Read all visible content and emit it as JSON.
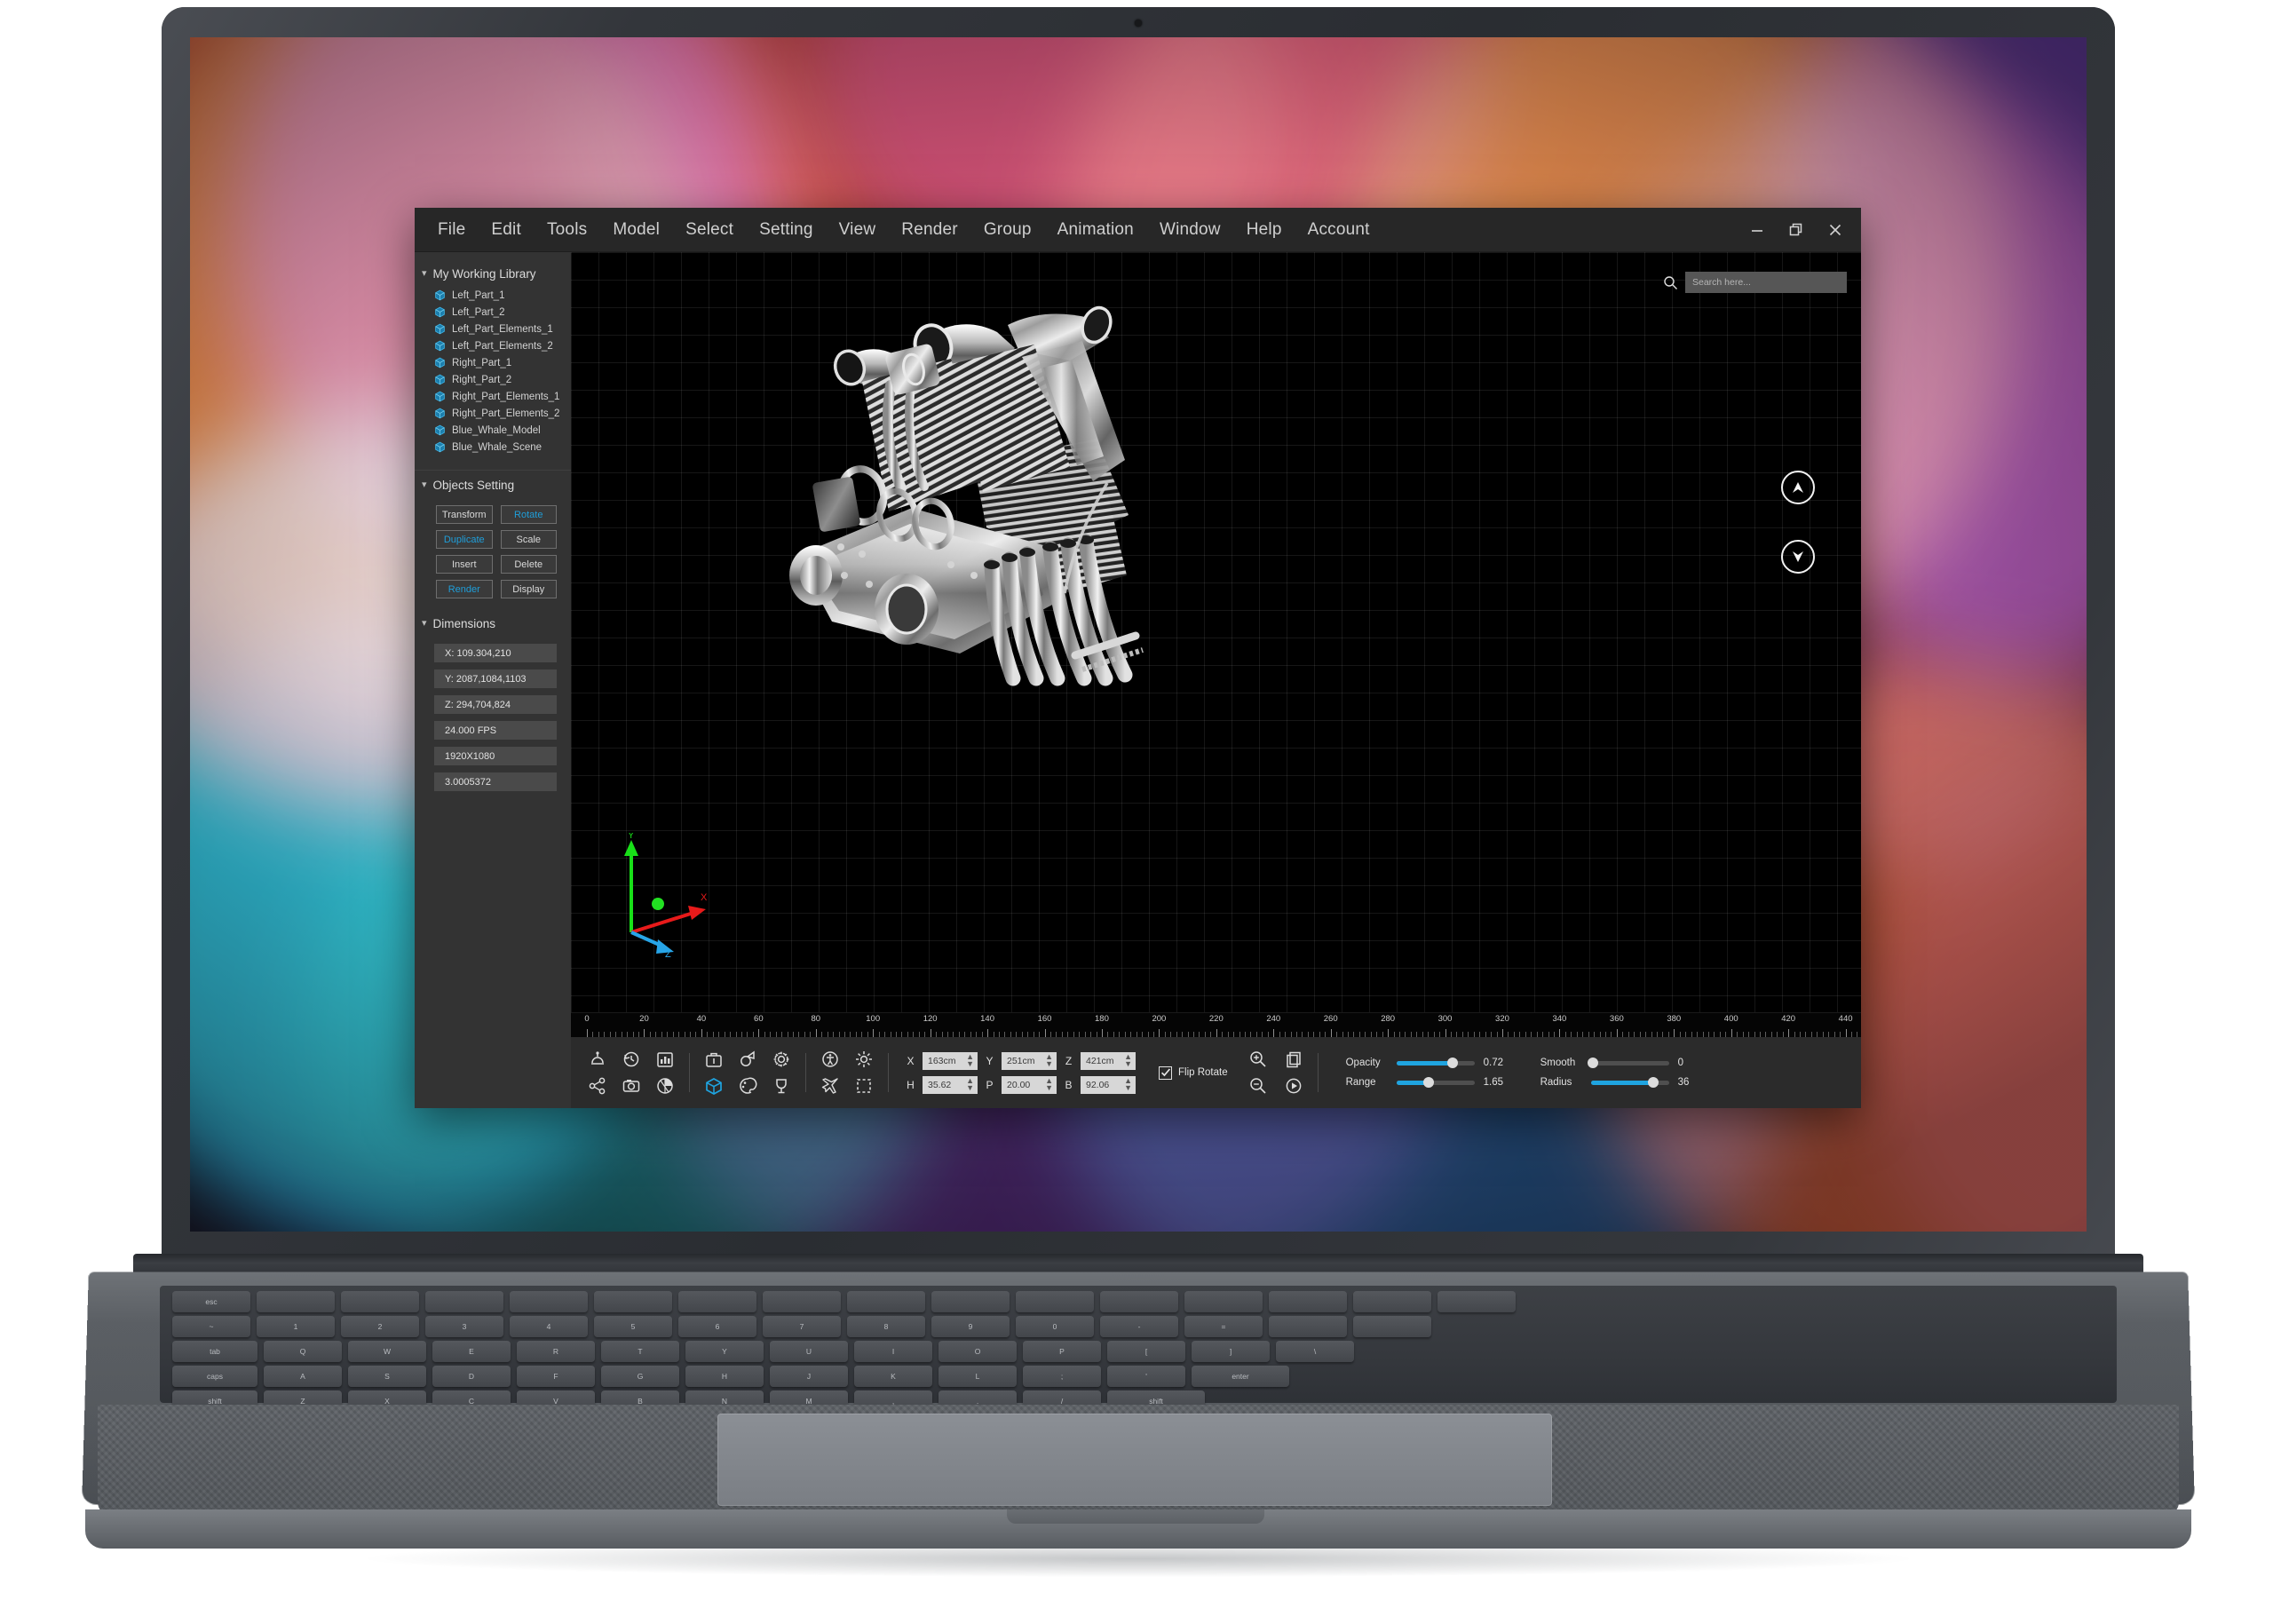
{
  "app": {
    "menu": [
      "File",
      "Edit",
      "Tools",
      "Model",
      "Select",
      "Setting",
      "View",
      "Render",
      "Group",
      "Animation",
      "Window",
      "Help",
      "Account"
    ],
    "window_controls": [
      {
        "name": "minimize-button",
        "label": "–"
      },
      {
        "name": "restore-button",
        "label": "❐"
      },
      {
        "name": "close-button",
        "label": "×"
      }
    ]
  },
  "sidebar": {
    "library": {
      "title": "My Working Library",
      "items": [
        {
          "label": "Left_Part_1"
        },
        {
          "label": "Left_Part_2"
        },
        {
          "label": "Left_Part_Elements_1"
        },
        {
          "label": "Left_Part_Elements_2"
        },
        {
          "label": "Right_Part_1"
        },
        {
          "label": "Right_Part_2"
        },
        {
          "label": "Right_Part_Elements_1"
        },
        {
          "label": "Right_Part_Elements_2"
        },
        {
          "label": "Blue_Whale_Model"
        },
        {
          "label": "Blue_Whale_Scene"
        }
      ]
    },
    "objects_setting": {
      "title": "Objects Setting",
      "buttons": [
        {
          "label": "Transform",
          "accent": false
        },
        {
          "label": "Rotate",
          "accent": true
        },
        {
          "label": "Duplicate",
          "accent": true
        },
        {
          "label": "Scale",
          "accent": false
        },
        {
          "label": "Insert",
          "accent": false
        },
        {
          "label": "Delete",
          "accent": false
        },
        {
          "label": "Render",
          "accent": true
        },
        {
          "label": "Display",
          "accent": false
        }
      ]
    },
    "dimensions": {
      "title": "Dimensions",
      "fields": [
        {
          "label": "X: 109.304,210"
        },
        {
          "label": "Y: 2087,1084,1103"
        },
        {
          "label": "Z: 294,704,824"
        },
        {
          "label": "24.000 FPS"
        },
        {
          "label": "1920X1080"
        },
        {
          "label": "3.0005372"
        }
      ]
    }
  },
  "viewport": {
    "search": {
      "placeholder": "Search here...",
      "value": ""
    },
    "nav": [
      {
        "name": "nav-up-button",
        "icon": "chevron-up-icon"
      },
      {
        "name": "nav-down-button",
        "icon": "chevron-down-icon"
      }
    ],
    "axes": [
      {
        "name": "y-axis",
        "label": "Y",
        "color": "#18e018"
      },
      {
        "name": "x-axis",
        "label": "X",
        "color": "#e81a1a"
      },
      {
        "name": "z-axis",
        "label": "Z",
        "color": "#27a5e8"
      }
    ],
    "ruler": {
      "labels": [
        0,
        20,
        40,
        60,
        80,
        100,
        120,
        140,
        160,
        180,
        200,
        220,
        240,
        260,
        280,
        300,
        320,
        340,
        360,
        380,
        400,
        420,
        440
      ],
      "unit_step": 20
    },
    "model_name": "V-Twin Engine"
  },
  "toolbar": {
    "icons_group1": [
      {
        "name": "bell-service-icon",
        "active": false
      },
      {
        "name": "share-nodes-icon",
        "active": false
      },
      {
        "name": "history-undo-icon",
        "active": false
      },
      {
        "name": "camera-icon",
        "active": false
      },
      {
        "name": "bar-chart-icon",
        "active": false
      },
      {
        "name": "pie-chart-icon",
        "active": false
      }
    ],
    "icons_group2": [
      {
        "name": "briefcase-icon",
        "active": false
      },
      {
        "name": "cube-icon",
        "active": true
      },
      {
        "name": "shape-transform-icon",
        "active": false
      },
      {
        "name": "palette-icon",
        "active": false
      },
      {
        "name": "gear-icon",
        "active": false
      },
      {
        "name": "trophy-icon",
        "active": false
      }
    ],
    "icons_group3": [
      {
        "name": "accessibility-icon",
        "active": false
      },
      {
        "name": "airplane-icon",
        "active": false
      },
      {
        "name": "brightness-sun-icon",
        "active": false
      },
      {
        "name": "marquee-select-icon",
        "active": false
      }
    ],
    "coords": [
      {
        "label": "X",
        "value": "163cm"
      },
      {
        "label": "Y",
        "value": "251cm"
      },
      {
        "label": "Z",
        "value": "421cm"
      },
      {
        "label": "H",
        "value": "35.62"
      },
      {
        "label": "P",
        "value": "20.00"
      },
      {
        "label": "B",
        "value": "92.06"
      }
    ],
    "flip_rotate": {
      "label": "Flip Rotate",
      "checked": true
    },
    "zoom_icons": [
      {
        "name": "zoom-in-icon"
      },
      {
        "name": "duplicate-page-icon"
      },
      {
        "name": "zoom-out-icon"
      },
      {
        "name": "play-icon"
      }
    ],
    "sliders": [
      {
        "name": "opacity-slider",
        "label": "Opacity",
        "value": "0.72",
        "pct": 72
      },
      {
        "name": "smooth-slider",
        "label": "Smooth",
        "value": "0",
        "pct": 3
      },
      {
        "name": "range-slider",
        "label": "Range",
        "value": "1.65",
        "pct": 41
      },
      {
        "name": "radius-slider",
        "label": "Radius",
        "value": "36",
        "pct": 80
      }
    ]
  },
  "colors": {
    "accent": "#1f9ed9",
    "slider_fill": "#1fa4e0",
    "panel_bg": "#333333",
    "window_bg": "#2b2b2b",
    "viewport_bg": "#000000"
  }
}
